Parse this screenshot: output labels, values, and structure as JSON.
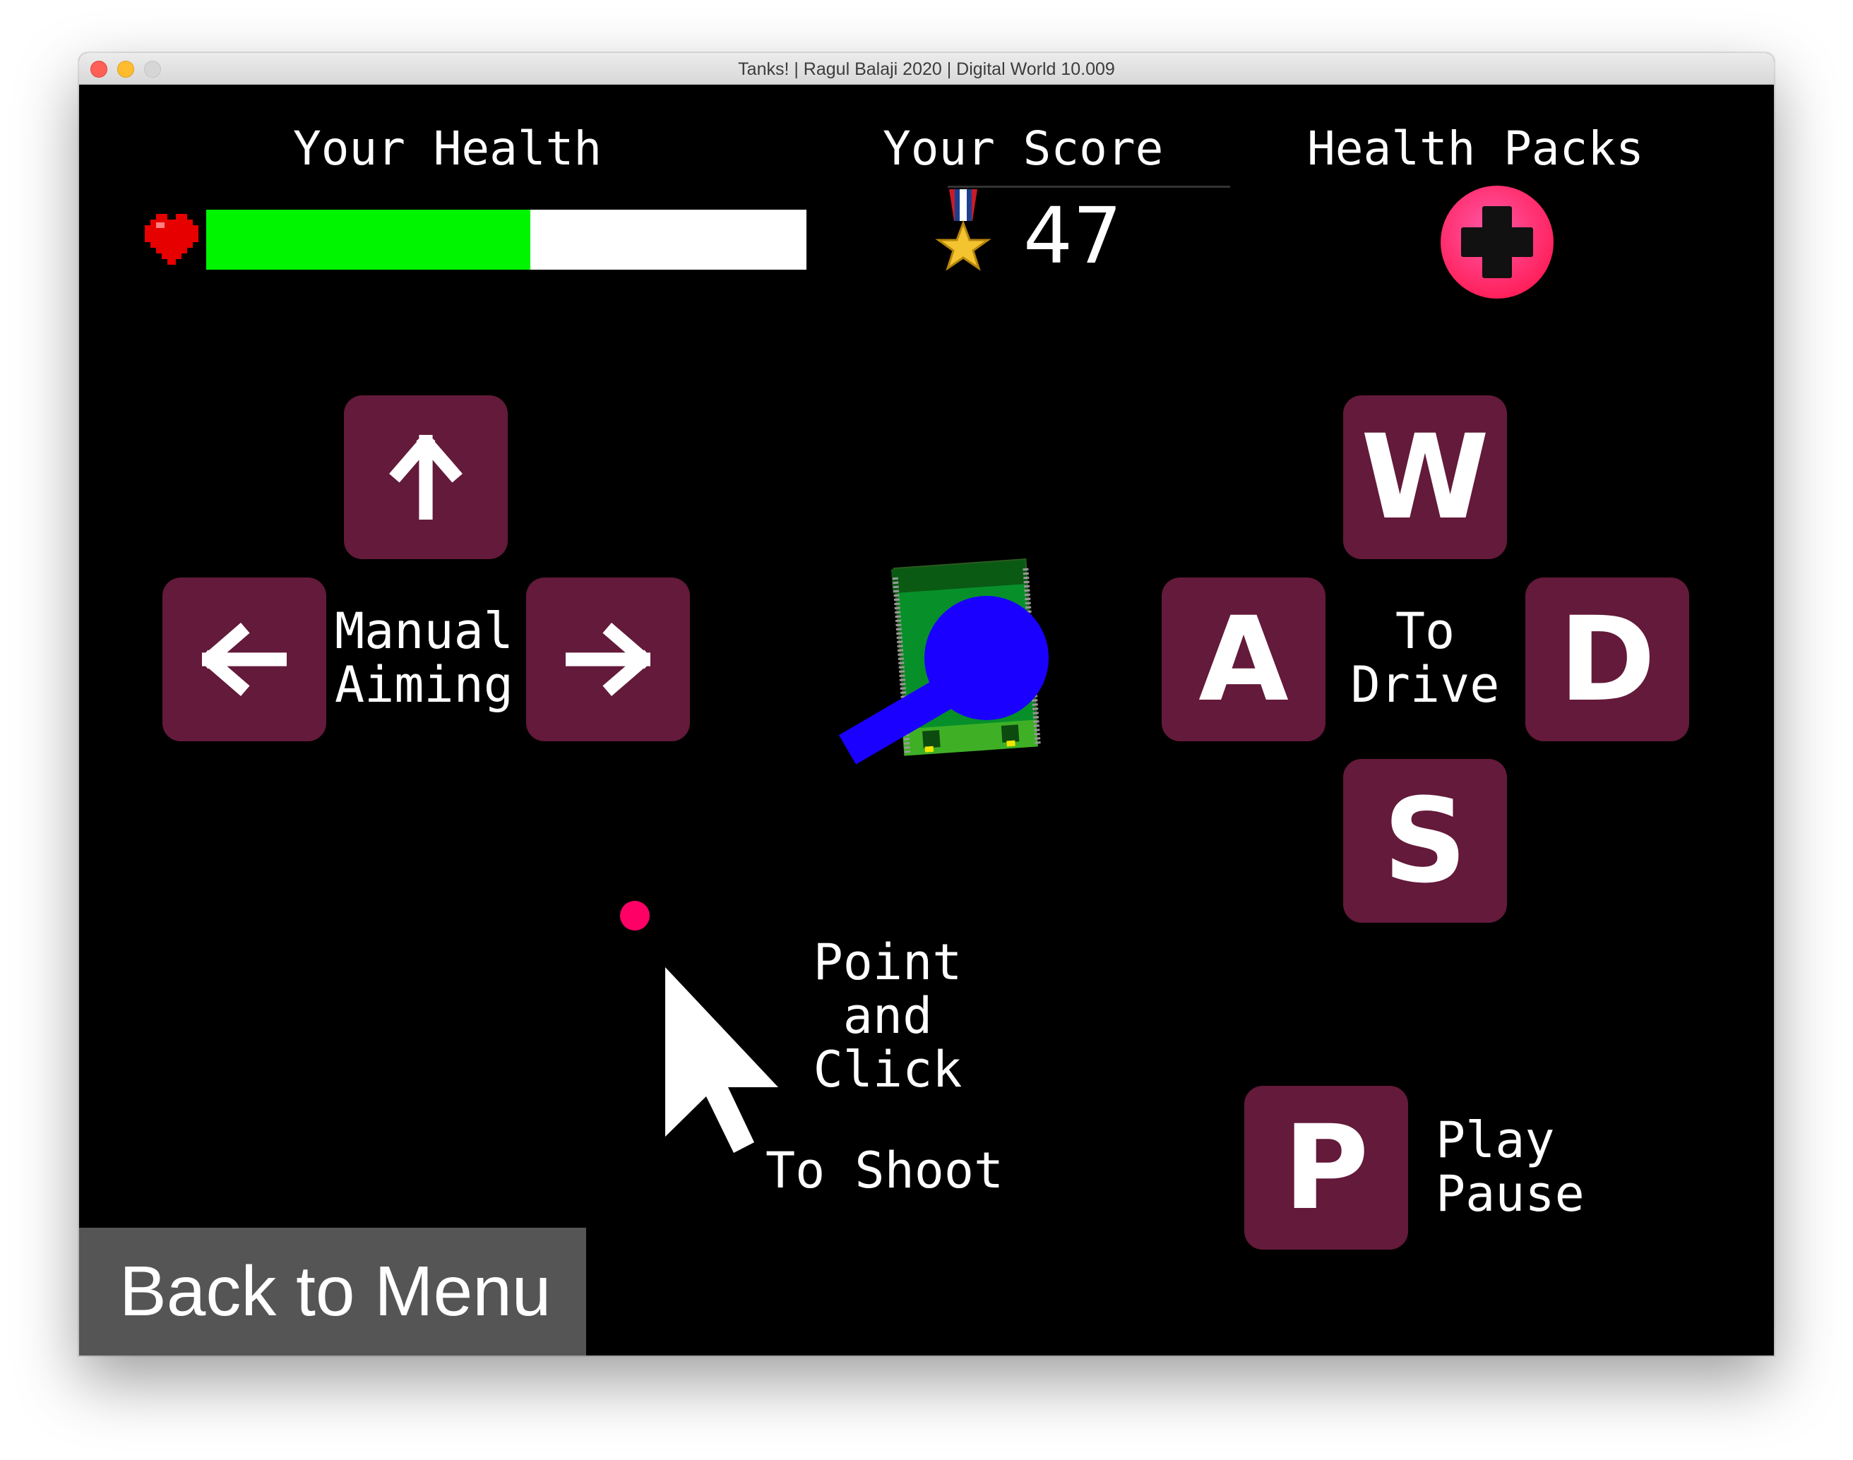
{
  "window": {
    "title": "Tanks! | Ragul Balaji 2020 | Digital World 10.009"
  },
  "hud": {
    "health_label": "Your Health",
    "health_fraction": 0.54,
    "score_label": "Your Score",
    "score_value": "47",
    "packs_label": "Health Packs",
    "packs_count": 1
  },
  "controls": {
    "aim_up_icon": "arrow-up-icon",
    "aim_left_icon": "arrow-left-icon",
    "aim_right_icon": "arrow-right-icon",
    "aim_label_line1": "Manual",
    "aim_label_line2": "Aiming",
    "key_w": "W",
    "key_a": "A",
    "key_s": "S",
    "key_d": "D",
    "drive_label_line1": "To",
    "drive_label_line2": "Drive",
    "shoot_line1": "Point",
    "shoot_line2": "and",
    "shoot_line3": "Click",
    "shoot_line4": "To Shoot",
    "key_p": "P",
    "pause_line1": "Play",
    "pause_line2": "Pause"
  },
  "colors": {
    "key_bg": "#641a3a",
    "health_fill": "#00f500",
    "tank_body": "#07902a",
    "turret": "#1a00ff",
    "crosshair": "#ff0066",
    "health_pack": "#ff2e88"
  },
  "back_button": {
    "label": "Back to Menu"
  }
}
